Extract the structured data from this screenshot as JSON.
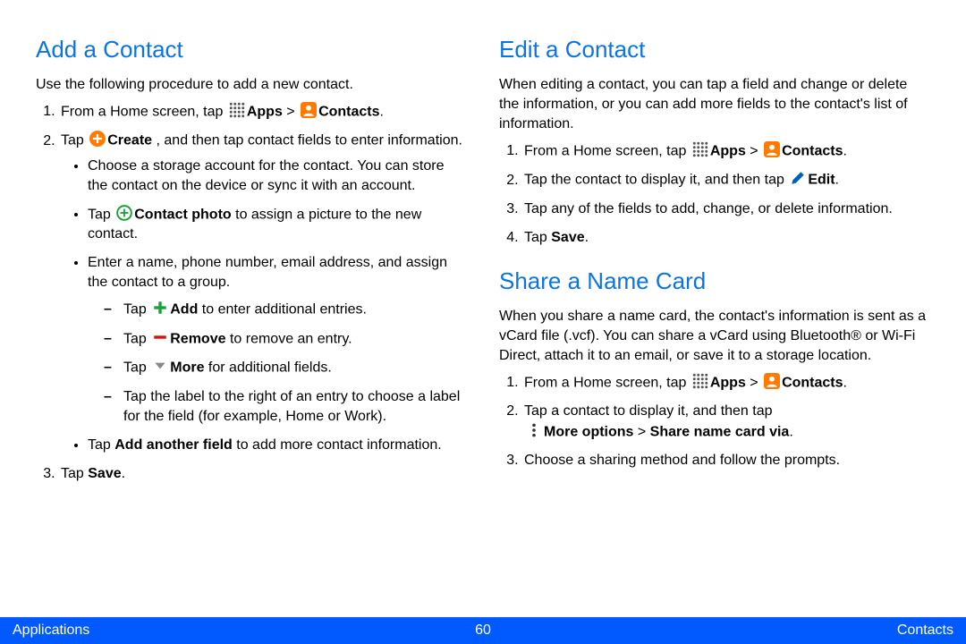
{
  "left": {
    "heading": "Add a Contact",
    "intro": "Use the following procedure to add a new contact.",
    "step1_a": "From a Home screen, tap ",
    "apps_grid_icon": "apps-grid-icon",
    "apps_bold": "Apps",
    "gt": " > ",
    "contacts_icon": "contacts-icon",
    "contacts_bold": "Contacts",
    "step2_a": "Tap ",
    "create_icon": "plus-orange-icon",
    "create_bold": "Create",
    "step2_b": " , and then tap contact fields to enter information.",
    "bullet1": "Choose a storage account for the contact. You can store the contact on the device or sync it with an account.",
    "bullet2_a": "Tap ",
    "contact_photo_icon": "plus-circle-icon",
    "contact_photo_bold": "Contact photo",
    "bullet2_b": " to assign a picture to the new contact.",
    "bullet3": "Enter a name, phone number, email address, and assign the contact to a group.",
    "dash1_a": "Tap ",
    "add_icon": "plus-green-icon",
    "add_bold": "Add",
    "dash1_b": " to enter additional entries.",
    "dash2_a": "Tap ",
    "remove_icon": "minus-red-icon",
    "remove_bold": "Remove",
    "dash2_b": " to remove an entry.",
    "dash3_a": "Tap ",
    "more_icon": "chevron-down-icon",
    "more_bold": "More",
    "dash3_b": " for additional fields.",
    "dash4": "Tap the label to the right of an entry to choose a label for the field (for example, Home or Work).",
    "bullet4_a": "Tap ",
    "add_another_bold": "Add another field",
    "bullet4_b": " to add more contact information.",
    "step3_a": "Tap ",
    "save_bold": "Save",
    "period": "."
  },
  "right": {
    "edit_heading": "Edit a Contact",
    "edit_intro": "When editing a contact, you can tap a field and change or delete the information, or you can add more fields to the contact's list of information.",
    "e_step1_a": "From a Home screen, tap ",
    "apps_bold": "Apps",
    "gt": " > ",
    "contacts_bold": "Contacts",
    "e_step2_a": "Tap the contact to display it, and then tap ",
    "edit_icon": "pencil-icon",
    "edit_bold": "Edit",
    "e_step3": "Tap any of the fields to add, change, or delete information.",
    "e_step4_a": "Tap ",
    "save_bold": "Save",
    "period": ".",
    "share_heading": "Share a Name Card",
    "share_intro": "When you share a name card, the contact's information is sent as a vCard file (.vcf). You can share a vCard using Bluetooth® or Wi-Fi Direct, attach it to an email, or save it to a storage location.",
    "s_step1_a": "From a Home screen, tap ",
    "s_step2_a": "Tap a contact to display it, and then tap ",
    "more_options_icon": "kebab-icon",
    "more_options_bold": "More options",
    "s_step2_b": " > ",
    "share_via_bold": "Share name card via",
    "s_step3": "Choose a sharing method and follow the prompts."
  },
  "footer": {
    "left": "Applications",
    "center": "60",
    "right": "Contacts"
  }
}
